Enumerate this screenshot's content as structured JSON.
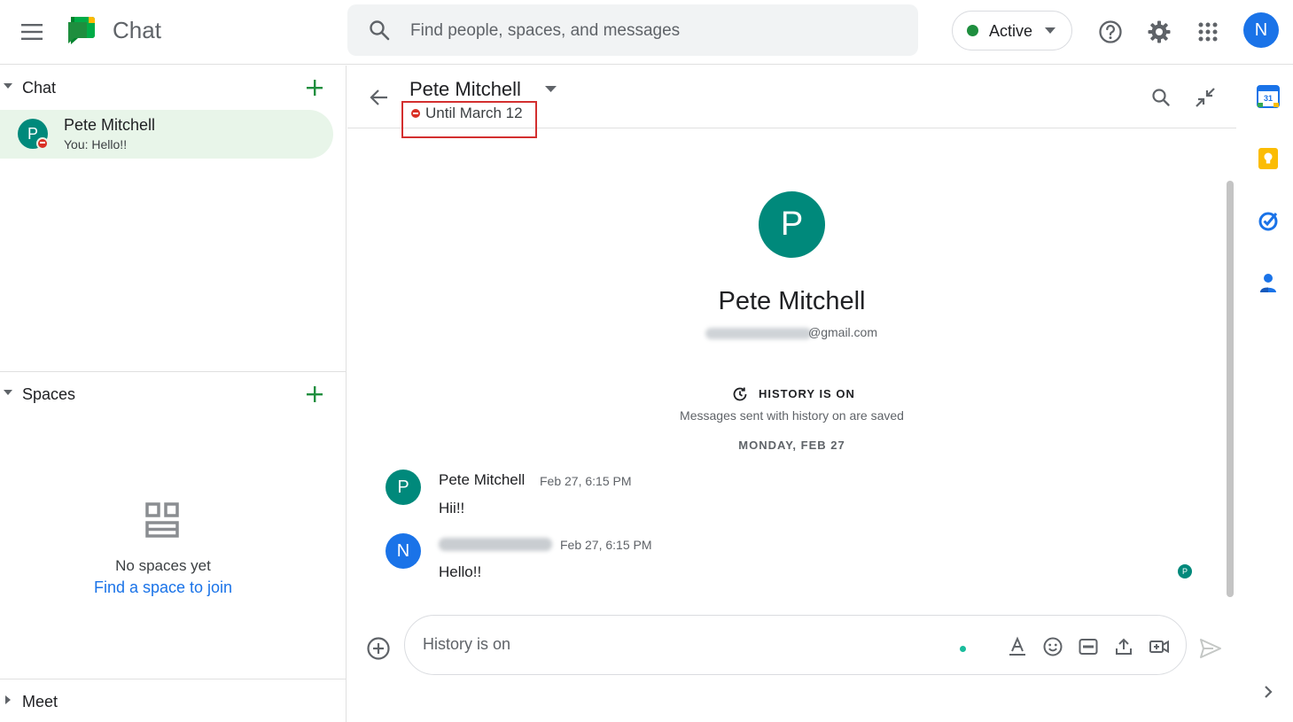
{
  "app": {
    "title": "Chat",
    "account_initial": "N"
  },
  "search": {
    "placeholder": "Find people, spaces, and messages"
  },
  "status": {
    "label": "Active",
    "color": "#1e8e3e"
  },
  "sidebar": {
    "chat_section": {
      "title": "Chat",
      "conversations": [
        {
          "initial": "P",
          "name": "Pete Mitchell",
          "snippet": "You: Hello!!",
          "status": "do-not-disturb"
        }
      ]
    },
    "spaces_section": {
      "title": "Spaces",
      "empty_text": "No spaces yet",
      "find_link": "Find a space to join"
    },
    "meet_section": {
      "title": "Meet"
    }
  },
  "conversation": {
    "name": "Pete Mitchell",
    "status_text": "Until March 12",
    "profile": {
      "initial": "P",
      "name": "Pete Mitchell",
      "email_domain": "@gmail.com"
    },
    "history": {
      "title": "HISTORY IS ON",
      "subtitle": "Messages sent with history on are saved"
    },
    "date_divider": "MONDAY, FEB 27",
    "messages": [
      {
        "initial": "P",
        "sender": "Pete Mitchell",
        "time": "Feb 27, 6:15 PM",
        "text": "Hii!!",
        "avatar_color": "#00897b"
      },
      {
        "initial": "N",
        "sender": "",
        "time": "Feb 27, 6:15 PM",
        "text": "Hello!!",
        "avatar_color": "#1a73e8"
      }
    ],
    "read_receipt_initial": "P"
  },
  "composer": {
    "placeholder": "History is on"
  },
  "colors": {
    "accent_green": "#1e8e3e",
    "brand_blue": "#1a73e8",
    "dnd_red": "#d93025",
    "highlight_box": "#d32f2f"
  }
}
